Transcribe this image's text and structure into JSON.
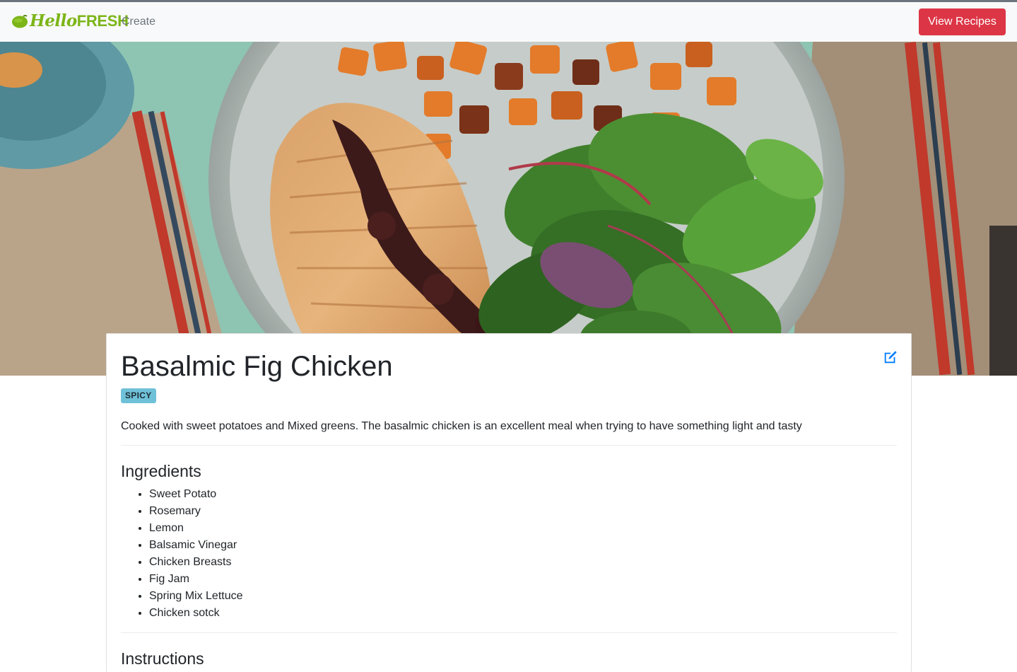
{
  "navbar": {
    "brand_main": "Hello",
    "brand_fresh": "FRESH",
    "create_label": "Create",
    "view_recipes_label": "View Recipes"
  },
  "recipe": {
    "title": "Basalmic Fig Chicken",
    "tag": "SPICY",
    "description": "Cooked with sweet potatoes and Mixed greens. The basalmic chicken is an excellent meal when trying to have something light and tasty",
    "ingredients_heading": "Ingredients",
    "ingredients": [
      "Sweet Potato",
      "Rosemary",
      "Lemon",
      "Balsamic Vinegar",
      "Chicken Breasts",
      "Fig Jam",
      "Spring Mix Lettuce",
      "Chicken sotck"
    ],
    "instructions_heading": "Instructions"
  },
  "icons": {
    "brand": "lime-icon",
    "edit": "edit-icon"
  },
  "colors": {
    "brand_green": "#7cb518",
    "primary_red": "#dc3545",
    "edit_blue": "#007bff",
    "badge_info": "#6fc1d8"
  }
}
